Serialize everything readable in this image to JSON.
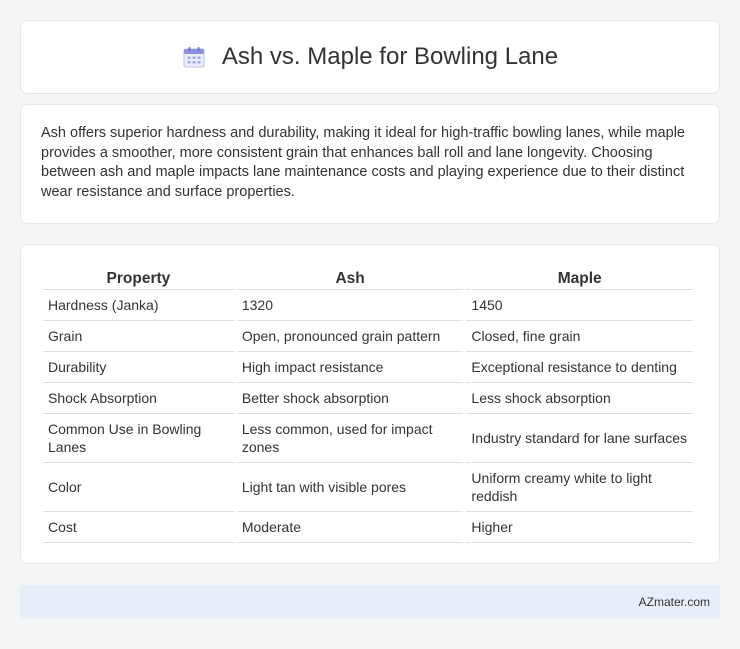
{
  "header": {
    "title": "Ash vs. Maple for Bowling Lane",
    "icon": "calendar-icon"
  },
  "intro": {
    "text": "Ash offers superior hardness and durability, making it ideal for high-traffic bowling lanes, while maple provides a smoother, more consistent grain that enhances ball roll and lane longevity. Choosing between ash and maple impacts lane maintenance costs and playing experience due to their distinct wear resistance and surface properties."
  },
  "table": {
    "headers": [
      "Property",
      "Ash",
      "Maple"
    ],
    "rows": [
      [
        "Hardness (Janka)",
        "1320",
        "1450"
      ],
      [
        "Grain",
        "Open, pronounced grain pattern",
        "Closed, fine grain"
      ],
      [
        "Durability",
        "High impact resistance",
        "Exceptional resistance to denting"
      ],
      [
        "Shock Absorption",
        "Better shock absorption",
        "Less shock absorption"
      ],
      [
        "Common Use in Bowling Lanes",
        "Less common, used for impact zones",
        "Industry standard for lane surfaces"
      ],
      [
        "Color",
        "Light tan with visible pores",
        "Uniform creamy white to light reddish"
      ],
      [
        "Cost",
        "Moderate",
        "Higher"
      ]
    ]
  },
  "footer": {
    "text": "AZmater.com"
  },
  "colors": {
    "background": "#f4f5f7",
    "card": "#ffffff",
    "footer_bg": "#e8eef8",
    "icon_accent": "#8b8fe0"
  }
}
